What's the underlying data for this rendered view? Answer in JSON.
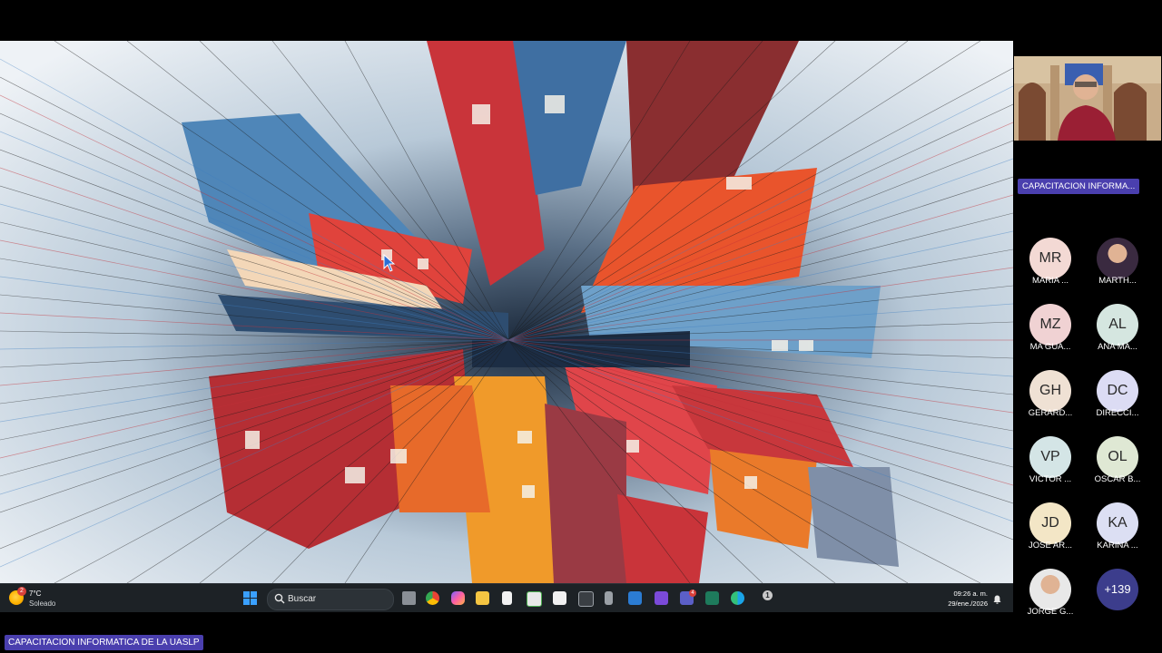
{
  "meeting": {
    "sidebar_title": "CAPACITACION INFORMA...",
    "footer_title": "CAPACITACION INFORMATICA DE LA UASLP"
  },
  "taskbar": {
    "weather": {
      "temp": "7°C",
      "desc": "Soleado",
      "badge": "2"
    },
    "search_placeholder": "Buscar",
    "app_badge": "4",
    "tray_alert": "1",
    "time": "09:26 a. m.",
    "date": "29/ene./2026"
  },
  "participants": [
    {
      "initials": "MR",
      "name": "MARIA ...",
      "color": "#f3d9d4"
    },
    {
      "initials": "",
      "name": "MARTH...",
      "color": "#3a2a40",
      "photo": true
    },
    {
      "initials": "MZ",
      "name": "MA GUA...",
      "color": "#f0d2d3"
    },
    {
      "initials": "AL",
      "name": "ANA MA...",
      "color": "#d5e6e0"
    },
    {
      "initials": "GH",
      "name": "GERARD...",
      "color": "#efe1d4"
    },
    {
      "initials": "DC",
      "name": "DIRECCI...",
      "color": "#dcdcf4"
    },
    {
      "initials": "VP",
      "name": "VICTOR ...",
      "color": "#d4e5e6"
    },
    {
      "initials": "OL",
      "name": "OSCAR B...",
      "color": "#dfe8d4"
    },
    {
      "initials": "JD",
      "name": "JOSE AR...",
      "color": "#f3e6c6"
    },
    {
      "initials": "KA",
      "name": "KARINA ...",
      "color": "#dcdff3"
    },
    {
      "initials": "",
      "name": "JORGE G...",
      "color": "#e8e8e8",
      "photo": true
    },
    {
      "initials": "+139",
      "name": "",
      "color": "#3c3d8c",
      "more": true
    }
  ],
  "colors": {
    "accent": "#4a3fae",
    "taskbar": "#1d2226"
  }
}
